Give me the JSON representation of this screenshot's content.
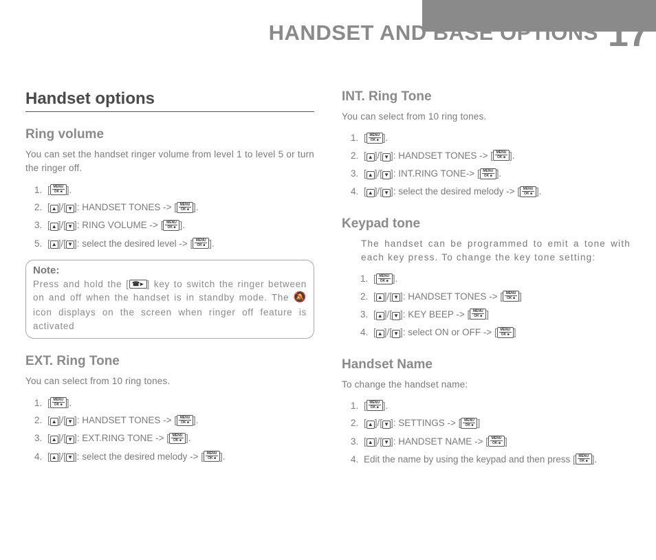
{
  "chapter_title": "HANDSET AND BASE OPTIONS",
  "chapter_number": "17",
  "left_column": {
    "section_title": "Handset options",
    "ring_volume": {
      "heading": "Ring volume",
      "intro": "You can set the handset ringer volume from level 1 to level 5 or turn the ringer off.",
      "steps": {
        "s2": ": HANDSET TONES -> ",
        "s3": ": RING VOLUME -> ",
        "s5": ": select the desired level -> "
      }
    },
    "note": {
      "title": "Note:",
      "part1": "Press and hold the ",
      "part2": " key to switch the ringer between on and off when the handset is in standby mode. The ",
      "part3": " icon displays on the screen when ringer off feature is activated"
    },
    "ext_ring": {
      "heading": "EXT. Ring Tone",
      "intro": "You can select from 10 ring tones.",
      "steps": {
        "s2": ": HANDSET TONES -> ",
        "s3": ": EXT.RING TONE -> ",
        "s4": ": select the desired melody -> "
      }
    }
  },
  "right_column": {
    "int_ring": {
      "heading": "INT. Ring Tone",
      "intro": "You can select from 10 ring tones.",
      "steps": {
        "s2": ": HANDSET TONES -> ",
        "s3": ": INT.RING TONE-> ",
        "s4": ": select the desired melody -> "
      }
    },
    "keypad": {
      "heading": "Keypad tone",
      "intro": "The handset can be programmed to emit a tone with each key press. To change the key tone setting:",
      "steps": {
        "s2": ": HANDSET TONES -> ",
        "s3": ": KEY BEEP -> ",
        "s4": ": select ON or OFF -> "
      }
    },
    "name": {
      "heading": "Handset Name",
      "intro": "To change the handset name:",
      "steps": {
        "s2": ": SETTINGS -> ",
        "s3": ": HANDSET NAME -> ",
        "s4": "Edit the name by using the keypad and then press "
      }
    }
  }
}
